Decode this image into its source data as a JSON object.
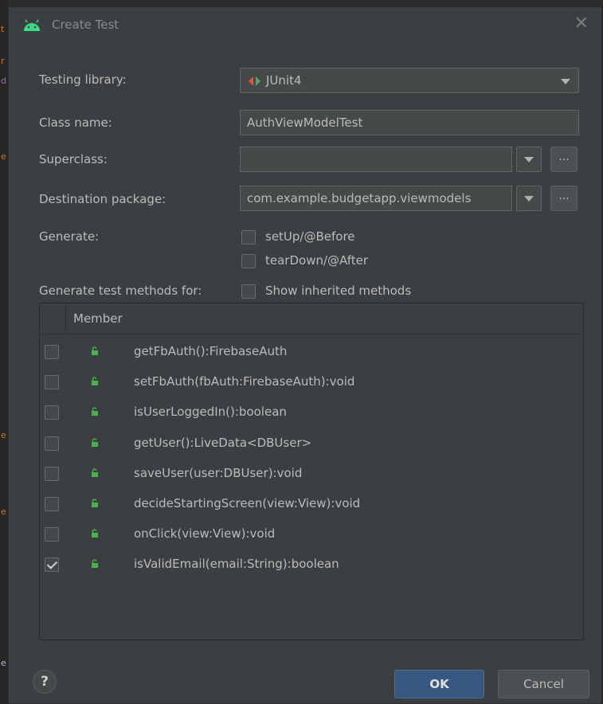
{
  "dialog": {
    "title": "Create Test",
    "close_glyph": "✕"
  },
  "fields": {
    "testing_library": {
      "label": "Testing library:",
      "value": "JUnit4"
    },
    "class_name": {
      "label": "Class name:",
      "value": "AuthViewModelTest"
    },
    "superclass": {
      "label": "Superclass:",
      "value": "",
      "dots": "..."
    },
    "destination_package": {
      "label": "Destination package:",
      "value": "com.example.budgetapp.viewmodels",
      "dots": "..."
    },
    "generate": {
      "label": "Generate:",
      "options": [
        {
          "label": "setUp/@Before",
          "checked": false
        },
        {
          "label": "tearDown/@After",
          "checked": false
        }
      ]
    },
    "generate_methods": {
      "label": "Generate test methods for:",
      "show_inherited_label": "Show inherited methods",
      "show_inherited_checked": false
    }
  },
  "table": {
    "header": "Member",
    "rows": [
      {
        "member": "getFbAuth():FirebaseAuth",
        "checked": false
      },
      {
        "member": "setFbAuth(fbAuth:FirebaseAuth):void",
        "checked": false
      },
      {
        "member": "isUserLoggedIn():boolean",
        "checked": false
      },
      {
        "member": "getUser():LiveData<DBUser>",
        "checked": false
      },
      {
        "member": "saveUser(user:DBUser):void",
        "checked": false
      },
      {
        "member": "decideStartingScreen(view:View):void",
        "checked": false
      },
      {
        "member": "onClick(view:View):void",
        "checked": false
      },
      {
        "member": "isValidEmail(email:String):boolean",
        "checked": true
      }
    ]
  },
  "buttons": {
    "help": "?",
    "ok": "OK",
    "cancel": "Cancel"
  },
  "colors": {
    "android_green": "#3ddc84",
    "lock_green": "#4caf50",
    "junit_red": "#e8542e",
    "junit_green": "#59a869",
    "ok_blue": "#365880"
  },
  "icons": {
    "app": "android-icon",
    "close": "close-icon",
    "library": "junit-icon",
    "member": "public-lock-icon",
    "help": "help-icon"
  }
}
